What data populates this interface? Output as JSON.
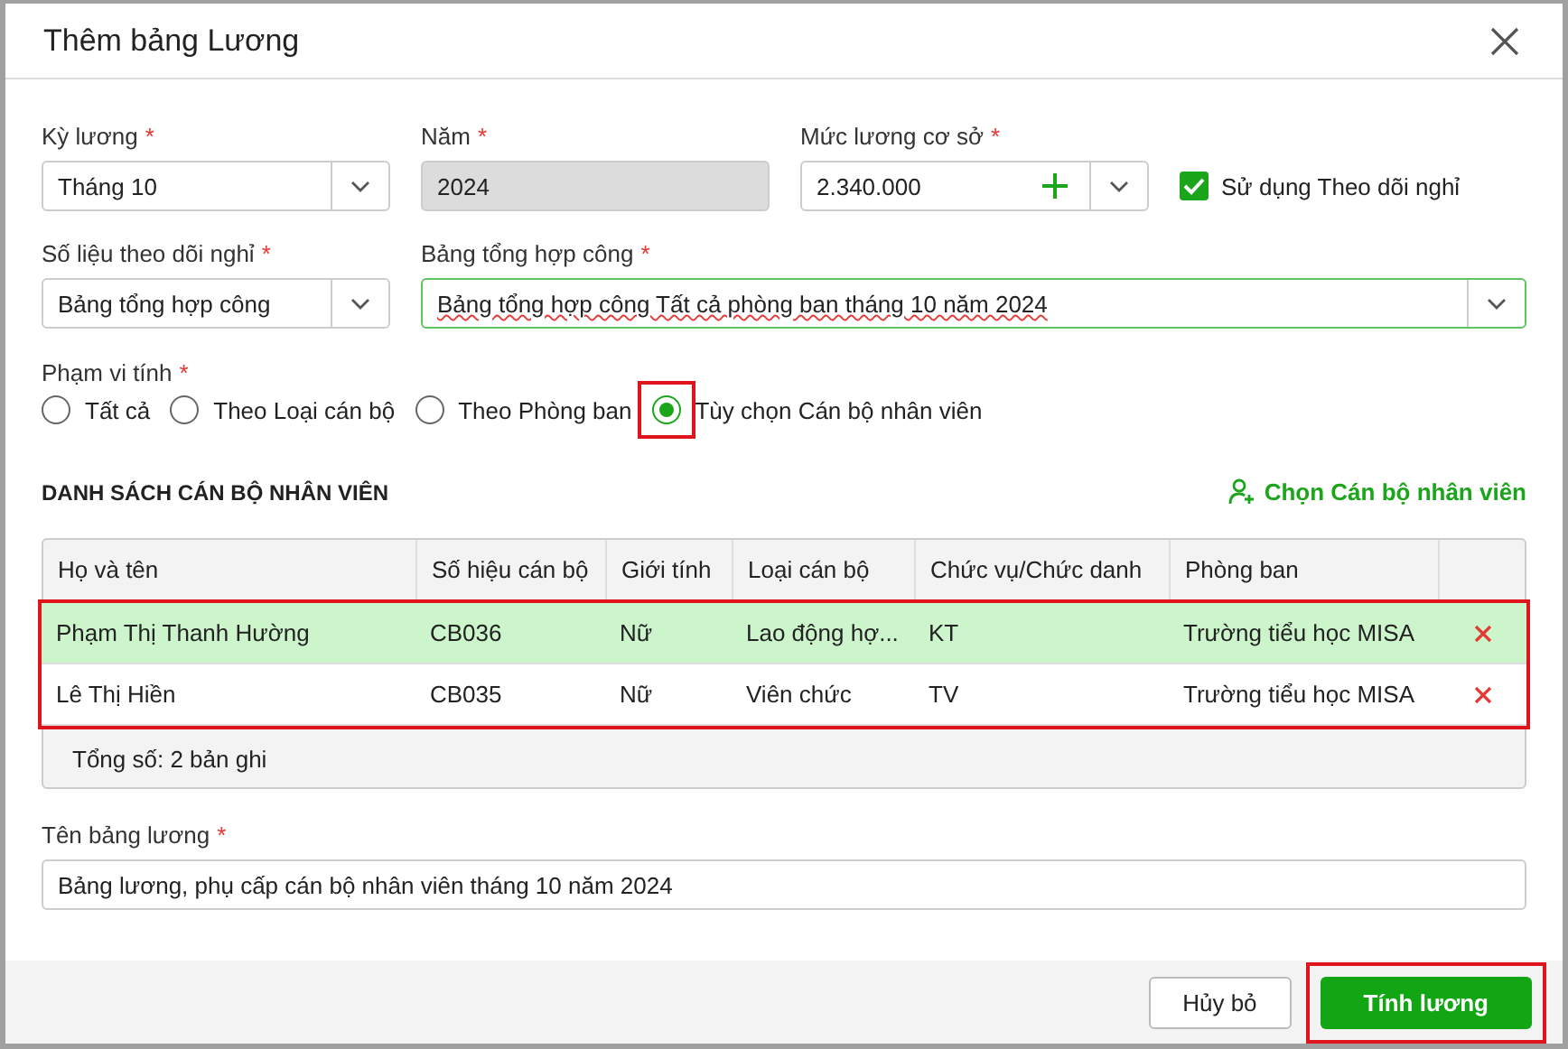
{
  "dialog": {
    "title": "Thêm bảng Lương"
  },
  "row1": [
    {
      "kind": "select",
      "label": "Kỳ lương",
      "required_mark": "*",
      "value": "Tháng 10"
    },
    {
      "kind": "readonly",
      "label": "Năm",
      "required_mark": "*",
      "value": "2024"
    },
    {
      "kind": "add-select",
      "label": "Mức lương cơ sở",
      "required_mark": "*",
      "value": "2.340.000"
    }
  ],
  "use_leave_tracking": {
    "label": "Sử dụng Theo dõi nghỉ",
    "checked": true
  },
  "row2": [
    {
      "kind": "select",
      "label": "Số liệu theo dõi nghỉ",
      "required_mark": "*",
      "value": "Bảng tổng hợp công"
    },
    {
      "kind": "select-focused",
      "label": "Bảng tổng hợp công",
      "required_mark": "*",
      "value": "Bảng tổng hợp công Tất cả phòng ban tháng 10 năm 2024"
    }
  ],
  "scope": {
    "label": "Phạm vi tính",
    "required_mark": "*",
    "options": [
      {
        "label": "Tất cả",
        "selected": false,
        "highlighted": false
      },
      {
        "label": "Theo Loại cán bộ",
        "selected": false,
        "highlighted": false
      },
      {
        "label": "Theo Phòng ban",
        "selected": false,
        "highlighted": false
      },
      {
        "label": "Tùy chọn Cán bộ nhân viên",
        "selected": true,
        "highlighted": true
      }
    ]
  },
  "staff_list": {
    "title": "DANH SÁCH CÁN BỘ NHÂN VIÊN",
    "action": "Chọn Cán bộ nhân viên"
  },
  "table": {
    "columns": [
      "Họ và tên",
      "Số hiệu cán bộ",
      "Giới tính",
      "Loại cán bộ",
      "Chức vụ/Chức danh",
      "Phòng ban"
    ],
    "rows_highlighted": true,
    "rows": [
      {
        "cells": [
          "Phạm Thị Thanh Hường",
          "CB036",
          "Nữ",
          "Lao động hợ...",
          "KT",
          "Trường tiểu học MISA"
        ],
        "selected": true
      },
      {
        "cells": [
          "Lê Thị Hiền",
          "CB035",
          "Nữ",
          "Viên chức",
          "TV",
          "Trường tiểu học MISA"
        ],
        "selected": false
      }
    ],
    "footer": "Tổng số: 2 bản ghi"
  },
  "payroll_name": {
    "label": "Tên bảng lương",
    "required_mark": "*",
    "value": "Bảng lương, phụ cấp cán bộ nhân viên tháng 10 năm 2024"
  },
  "buttons": [
    {
      "kind": "secondary",
      "label": "Hủy bỏ",
      "highlighted": false
    },
    {
      "kind": "primary",
      "label": "Tính lương",
      "highlighted": true
    }
  ]
}
